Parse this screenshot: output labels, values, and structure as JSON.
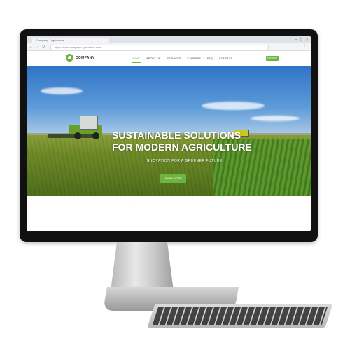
{
  "browser": {
    "tab_title": "Company - Agriculture",
    "url": "https://www.company-agriculture.com",
    "back_icon": "arrow-left-icon",
    "forward_icon": "arrow-right-icon",
    "reload_icon": "reload-icon",
    "menu_icon": "kebab-menu-icon",
    "window_controls": [
      "–",
      "□",
      "×"
    ]
  },
  "site": {
    "logo_text": "COMPANY",
    "nav": [
      "HOME",
      "ABOUT US",
      "SERVICES",
      "CAREERS",
      "FAQ",
      "CONTACT"
    ],
    "active_nav_index": 0,
    "cta_label": "CONTACT",
    "accent_color": "#6cb33f"
  },
  "hero": {
    "title_line1": "SUSTAINABLE SOLUTIONS",
    "title_line2": "FOR MODERN AGRICULTURE",
    "subtitle": "INNOVATION FOR A GREENER FUTURE",
    "button_label": "LEARN MORE"
  }
}
